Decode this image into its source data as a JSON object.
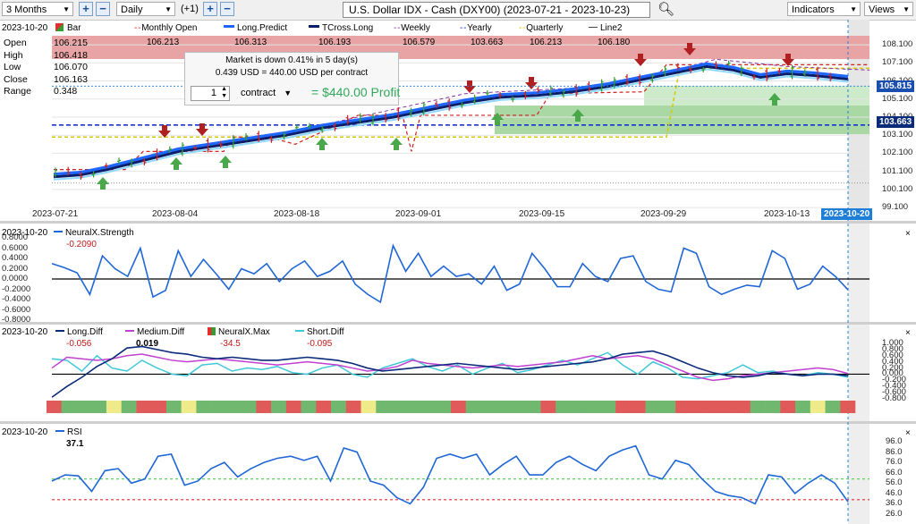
{
  "toolbar": {
    "period": "3 Months",
    "interval": "Daily",
    "offset": "(+1)",
    "title": "U.S. Dollar IDX - Cash (DXY00) (2023-07-21 - 2023-10-23)",
    "indicators_label": "Indicators",
    "views_label": "Views"
  },
  "main": {
    "date": "2023-10-20",
    "legend": {
      "bar": "Bar",
      "monthly_open": "Monthly Open",
      "long_predict": "Long.Predict",
      "tcross_long": "TCross.Long",
      "weekly": "Weekly",
      "yearly": "Yearly",
      "quarterly": "Quarterly",
      "line2": "Line2"
    },
    "ohlc": {
      "open_label": "Open",
      "open": "106.215",
      "high_label": "High",
      "high": "106.418",
      "low_label": "Low",
      "low": "106.070",
      "close_label": "Close",
      "close": "106.163",
      "range_label": "Range",
      "range": "0.348"
    },
    "legend_values": {
      "monthly_open": "106.213",
      "long_predict": "106.313",
      "tcross_long": "106.193",
      "weekly": "106.579",
      "yearly": "103.663",
      "quarterly": "106.213",
      "line2": "106.180"
    },
    "popup": {
      "line1": "Market is down 0.41% in 5 day(s)",
      "line2": "0.439 USD = 440.00 USD per contract",
      "qty": "1",
      "unit": "contract",
      "profit": "= $440.00 Profit"
    },
    "price_tags": {
      "close": "105.815",
      "yearly": "103.663"
    },
    "y_ticks": [
      "108.100",
      "107.100",
      "106.100",
      "105.100",
      "104.100",
      "103.100",
      "102.100",
      "101.100",
      "100.100",
      "99.100"
    ],
    "x_ticks": [
      "2023-07-21",
      "2023-08-04",
      "2023-08-18",
      "2023-09-01",
      "2023-09-15",
      "2023-09-29",
      "2023-10-13"
    ],
    "x_current": "2023-10-20"
  },
  "strength": {
    "date": "2023-10-20",
    "name": "NeuralX.Strength",
    "value": "-0.2090",
    "y_ticks": [
      "0.8000",
      "0.6000",
      "0.4000",
      "0.2000",
      "0.0000",
      "-0.2000",
      "-0.4000",
      "-0.6000",
      "-0.8000"
    ],
    "values": [
      0.3,
      0.22,
      0.12,
      -0.3,
      0.45,
      0.2,
      0.05,
      0.6,
      -0.35,
      -0.22,
      0.55,
      0.05,
      0.38,
      0.1,
      -0.2,
      0.2,
      0.1,
      0.3,
      -0.05,
      0.2,
      0.35,
      0.05,
      0.15,
      0.35,
      -0.1,
      -0.3,
      -0.45,
      0.65,
      0.15,
      0.5,
      0.05,
      0.25,
      0.05,
      0.1,
      -0.1,
      0.25,
      -0.22,
      -0.1,
      0.5,
      0.2,
      -0.15,
      -0.15,
      0.3,
      0.05,
      -0.05,
      0.4,
      0.45,
      -0.05,
      -0.2,
      -0.25,
      0.6,
      0.5,
      -0.15,
      -0.3,
      -0.2,
      -0.12,
      -0.15,
      0.55,
      0.4,
      -0.2,
      -0.1,
      0.25,
      0.05,
      -0.21
    ],
    "colors": {
      "line": "#1f66d6"
    }
  },
  "diff": {
    "date": "2023-10-20",
    "long_name": "Long.Diff",
    "long_value": "-0.056",
    "medium_name": "Medium.Diff",
    "medium_value": "0.019",
    "max_name": "NeuralX.Max",
    "max_value": "-34.5",
    "short_name": "Short.Diff",
    "short_value": "-0.095",
    "y_ticks": [
      "1.000",
      "0.800",
      "0.600",
      "0.400",
      "0.200",
      "0.000",
      "-0.200",
      "-0.400",
      "-0.600",
      "-0.800"
    ],
    "long_values": [
      -0.75,
      -0.4,
      -0.1,
      0.25,
      0.5,
      0.85,
      0.9,
      0.8,
      0.7,
      0.65,
      0.55,
      0.5,
      0.55,
      0.5,
      0.45,
      0.45,
      0.5,
      0.55,
      0.5,
      0.45,
      0.35,
      0.2,
      0.1,
      0.15,
      0.2,
      0.25,
      0.3,
      0.35,
      0.3,
      0.25,
      0.2,
      0.15,
      0.2,
      0.25,
      0.3,
      0.35,
      0.4,
      0.5,
      0.65,
      0.7,
      0.75,
      0.6,
      0.4,
      0.2,
      0.05,
      -0.05,
      -0.1,
      -0.05,
      0.05,
      0.0,
      -0.05,
      0.0,
      0.0,
      -0.05
    ],
    "medium_values": [
      0.2,
      0.55,
      0.5,
      0.45,
      0.5,
      0.6,
      0.65,
      0.55,
      0.45,
      0.4,
      0.45,
      0.5,
      0.45,
      0.4,
      0.35,
      0.3,
      0.35,
      0.4,
      0.35,
      0.3,
      0.2,
      0.1,
      0.15,
      0.25,
      0.45,
      0.35,
      0.3,
      0.25,
      0.2,
      0.25,
      0.3,
      0.25,
      0.3,
      0.35,
      0.4,
      0.5,
      0.6,
      0.5,
      0.55,
      0.6,
      0.5,
      0.3,
      0.1,
      -0.1,
      -0.2,
      -0.15,
      -0.05,
      0.0,
      0.05,
      0.1,
      0.15,
      0.2,
      0.15,
      0.02
    ],
    "short_values": [
      0.5,
      0.45,
      0.1,
      0.6,
      0.2,
      0.1,
      0.45,
      0.2,
      0.0,
      -0.05,
      0.3,
      0.35,
      0.1,
      0.2,
      0.15,
      0.25,
      0.05,
      0.0,
      0.2,
      0.3,
      0.0,
      -0.1,
      0.2,
      0.35,
      0.5,
      0.25,
      0.1,
      0.3,
      0.0,
      0.2,
      0.35,
      0.05,
      0.15,
      0.3,
      0.45,
      0.3,
      0.5,
      0.7,
      0.3,
      0.0,
      0.4,
      0.2,
      -0.1,
      -0.15,
      -0.05,
      0.05,
      0.3,
      0.05,
      0.1,
      0.0,
      -0.05,
      0.05,
      0.0,
      -0.1
    ],
    "max_bar_colors": [
      "#e05a5a",
      "#70b870",
      "#70b870",
      "#70b870",
      "#f0eb8a",
      "#70b870",
      "#e05a5a",
      "#e05a5a",
      "#70b870",
      "#f0eb8a",
      "#70b870",
      "#70b870",
      "#70b870",
      "#70b870",
      "#e05a5a",
      "#70b870",
      "#e05a5a",
      "#70b870",
      "#e05a5a",
      "#70b870",
      "#e05a5a",
      "#f0eb8a",
      "#70b870",
      "#70b870",
      "#70b870",
      "#70b870",
      "#70b870",
      "#e05a5a",
      "#70b870",
      "#70b870",
      "#70b870",
      "#70b870",
      "#70b870",
      "#e05a5a",
      "#70b870",
      "#70b870",
      "#70b870",
      "#70b870",
      "#e05a5a",
      "#e05a5a",
      "#70b870",
      "#70b870",
      "#e05a5a",
      "#e05a5a",
      "#e05a5a",
      "#e05a5a",
      "#e05a5a",
      "#70b870",
      "#70b870",
      "#e05a5a",
      "#70b870",
      "#f0eb8a",
      "#70b870",
      "#e05a5a"
    ],
    "colors": {
      "long": "#0a2a7a",
      "medium": "#c040d0",
      "short": "#40c8d8"
    }
  },
  "rsi": {
    "date": "2023-10-20",
    "name": "RSI",
    "value": "37.1",
    "y_ticks": [
      "96.0",
      "86.0",
      "76.0",
      "66.0",
      "56.0",
      "46.0",
      "36.0",
      "26.0"
    ],
    "values": [
      58,
      64,
      63,
      48,
      68,
      70,
      56,
      60,
      82,
      84,
      54,
      58,
      70,
      76,
      62,
      70,
      76,
      80,
      82,
      78,
      82,
      58,
      90,
      86,
      58,
      54,
      42,
      36,
      52,
      80,
      84,
      80,
      84,
      64,
      74,
      82,
      64,
      64,
      76,
      82,
      74,
      68,
      82,
      88,
      92,
      64,
      60,
      78,
      74,
      60,
      48,
      44,
      42,
      36,
      64,
      62,
      46,
      56,
      64,
      56,
      38
    ],
    "upper_line": 60,
    "lower_line": 40,
    "colors": {
      "line": "#1f66d6"
    }
  }
}
